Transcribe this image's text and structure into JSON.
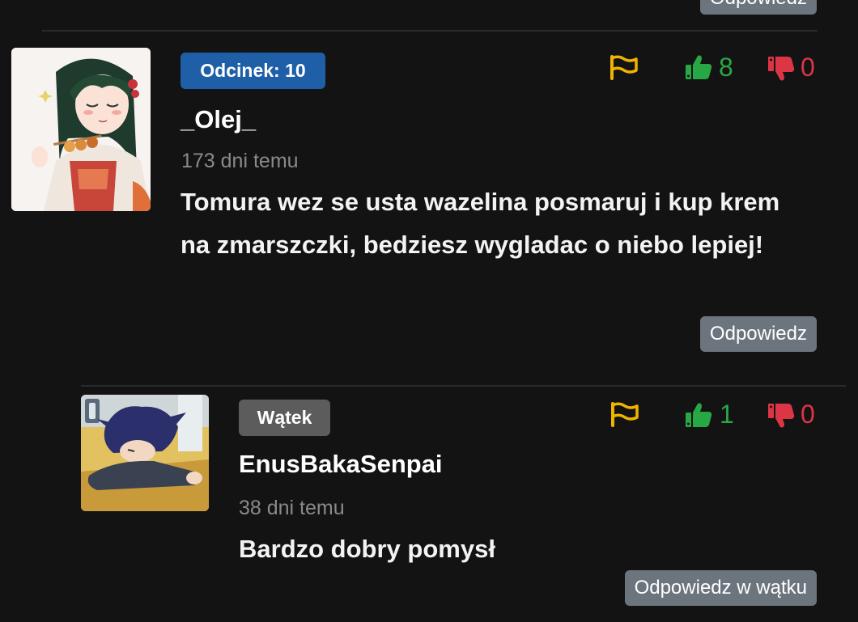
{
  "top_comment": {
    "reply_label": "Odpowiedz"
  },
  "comment_main": {
    "badge": "Odcinek: 10",
    "username": "_Olej_",
    "time_ago": "173 dni temu",
    "text": "Tomura wez se usta wazelina posmaruj i kup krem na zmarszczki, bedziesz wygladac o niebo lepiej!",
    "likes": "8",
    "dislikes": "0",
    "reply_label": "Odpowiedz",
    "avatar_icon": "anime-girl-avatar"
  },
  "comment_reply": {
    "badge": "Wątek",
    "username": "EnusBakaSenpai",
    "time_ago": "38 dni temu",
    "text": "Bardzo dobry pomysł",
    "likes": "1",
    "dislikes": "0",
    "reply_label": "Odpowiedz w wątku",
    "avatar_icon": "anime-boy-sleeping-avatar"
  },
  "colors": {
    "background": "#131313",
    "badge_episode": "#1e5fa8",
    "badge_thread": "#5c5c5c",
    "button": "#6c757d",
    "report_flag": "#f0b400",
    "like": "#28a745",
    "dislike": "#dc3545",
    "muted_text": "#8a8a8a"
  }
}
